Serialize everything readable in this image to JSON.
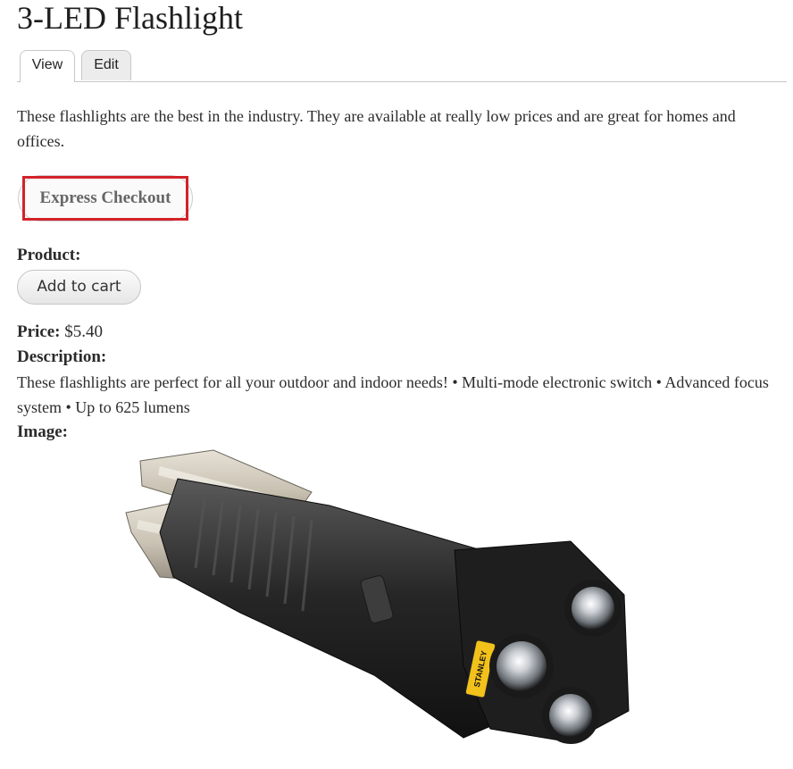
{
  "page": {
    "title": "3-LED Flashlight"
  },
  "tabs": [
    {
      "label": "View"
    },
    {
      "label": "Edit"
    }
  ],
  "intro": "These flashlights are the best in the industry. They are available at really low prices and are great for homes and offices.",
  "express_checkout": {
    "label": "Express Checkout"
  },
  "product": {
    "label": "Product:",
    "add_to_cart": "Add to cart"
  },
  "price": {
    "label": "Price:",
    "value": "$5.40"
  },
  "description": {
    "label": "Description:",
    "text": "These flashlights are perfect for all your outdoor and indoor needs! • Multi-mode electronic switch • Advanced focus system • Up to 625 lumens"
  },
  "image": {
    "label": "Image:",
    "brand_text": "STANLEY"
  },
  "colors": {
    "highlight": "#d2232a",
    "flashlight_body": "#2a2a2a",
    "brand_yellow": "#f2c21b"
  }
}
